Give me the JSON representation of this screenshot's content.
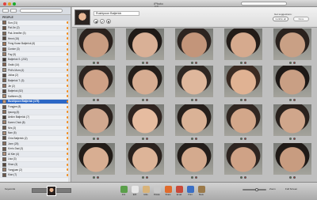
{
  "window": {
    "title": "iPhoto",
    "tabs": "Edit",
    "lights": [
      "#e0443e",
      "#dea123",
      "#1aab29"
    ]
  },
  "sidebar": {
    "section_header": "PEOPLE",
    "people": [
      {
        "label": "Sun (21)",
        "color": "#8a6a55"
      },
      {
        "label": "Pat Jie (2)",
        "color": "#6d5443"
      },
      {
        "label": "Pak Jennifer (3)",
        "color": "#7f6b59"
      },
      {
        "label": "Henri (15)",
        "color": "#55473d"
      },
      {
        "label": "Feng Kwan Batjerlok (6)",
        "color": "#a27758"
      },
      {
        "label": "Cunice (3)",
        "color": "#7a5c4a"
      },
      {
        "label": "Fay (5)",
        "color": "#9b7d68"
      },
      {
        "label": "Batjerlok S. (232)",
        "color": "#3f3430"
      },
      {
        "label": "Gwiki (14)",
        "color": "#866551"
      },
      {
        "label": "Phil's Mum (4)",
        "color": "#a38d7b"
      },
      {
        "label": "Julius (2)",
        "color": "#5a4a40"
      },
      {
        "label": "Batjerlok T. (3)",
        "color": "#7d6453"
      },
      {
        "label": "Jie (2)",
        "color": "#967360"
      },
      {
        "label": "Batjerlok (52)",
        "color": "#5e4b3f"
      },
      {
        "label": "Kathleen (5)",
        "color": "#b08a70"
      },
      {
        "label": "Rushipoon Batjerlok (175)",
        "color": "#c99a7a",
        "selected": true
      },
      {
        "label": "Fongjee (8)",
        "color": "#6a5446"
      },
      {
        "label": "Ipsung (5)",
        "color": "#8c6e5a"
      },
      {
        "label": "Aekim Batjerlok (7)",
        "color": "#4e3f36"
      },
      {
        "label": "Karen Chok (8)",
        "color": "#9f806b"
      },
      {
        "label": "Mrs (3)",
        "color": "#705a4b"
      },
      {
        "label": "Nan (5)",
        "color": "#a98b76"
      },
      {
        "label": "Chia Batjerlok (2)",
        "color": "#5d4c41"
      },
      {
        "label": "Jonn (25)",
        "color": "#8a705e"
      },
      {
        "label": "Kim's Dad (3)",
        "color": "#6f594b"
      },
      {
        "label": "Ai Kim (4)",
        "color": "#b3927b"
      },
      {
        "label": "Lisa (3)",
        "color": "#7e6251"
      },
      {
        "label": "Shan (3)",
        "color": "#564539"
      },
      {
        "label": "Yongjuan (2)",
        "color": "#9a7b66"
      },
      {
        "label": "Kian (7)",
        "color": "#6c5647"
      }
    ]
  },
  "header": {
    "name": "Rushipoon Batjerlok",
    "suggest_label": "Get suggestions:",
    "suggest_button": "Confirm all",
    "done_button": "Done",
    "icons": [
      "◀",
      "✔",
      "✖"
    ]
  },
  "photos": [
    {
      "bg": "#c99d82",
      "hair": "#2a211d"
    },
    {
      "bg": "#d9b096",
      "hair": "#1f1a17"
    },
    {
      "bg": "#c3957a",
      "hair": "#2d2420"
    },
    {
      "bg": "#d6aa8e",
      "hair": "#231c18"
    },
    {
      "bg": "#c9a085",
      "hair": "#2a221e"
    },
    {
      "bg": "#cfa186",
      "hair": "#2c231f"
    },
    {
      "bg": "#d7ad92",
      "hair": "#231d19"
    },
    {
      "bg": "#dfb79c",
      "hair": "#2e2622"
    },
    {
      "bg": "#e0b293",
      "hair": "#3a2a22"
    },
    {
      "bg": "#c99f84",
      "hair": "#1d1816"
    },
    {
      "bg": "#d1a88f",
      "hair": "#2b221e"
    },
    {
      "bg": "#e6bca0",
      "hair": "#2f2420"
    },
    {
      "bg": "#dab296",
      "hair": "#261f1b"
    },
    {
      "bg": "#d3a78a",
      "hair": "#302621"
    },
    {
      "bg": "#d0a68b",
      "hair": "#29211d"
    },
    {
      "bg": "#d8ae92",
      "hair": "#221c18"
    },
    {
      "bg": "#ddb498",
      "hair": "#2a221e"
    },
    {
      "bg": "#d4aa8e",
      "hair": "#231d1a"
    },
    {
      "bg": "#cfa286",
      "hair": "#2d2420"
    },
    {
      "bg": "#c89c80",
      "hair": "#201a17"
    }
  ],
  "toolbar": {
    "tools": [
      {
        "label": "Info",
        "color": "#5a9f4a"
      },
      {
        "label": "Edit",
        "color": "#e8e8e8"
      },
      {
        "label": "Hide",
        "color": "#d8b37a"
      },
      {
        "label": "Rotate",
        "color": "#c9c9c9"
      },
      {
        "label": "Share",
        "color": "#e06b2c"
      },
      {
        "label": "Email",
        "color": "#c84a3a"
      },
      {
        "label": "Print",
        "color": "#3a6fc4"
      },
      {
        "label": "Book",
        "color": "#9b7a4a"
      }
    ],
    "zoom_label": "Zoom",
    "left_label": "Keywords",
    "right_label": "Full Screen"
  }
}
